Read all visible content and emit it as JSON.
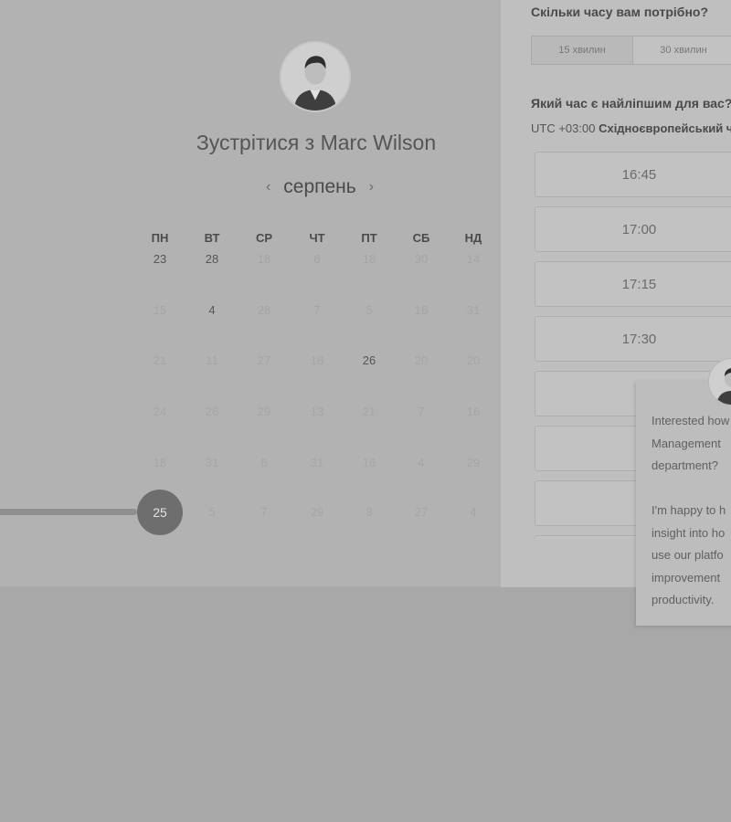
{
  "host": {
    "meet_title": "Зустрітися з Marc Wilson"
  },
  "calendar": {
    "prev_arrow": "‹",
    "next_arrow": "›",
    "month": "серпень",
    "weekdays": [
      "ПН",
      "ВТ",
      "СР",
      "ЧТ",
      "ПТ",
      "СБ",
      "НД"
    ],
    "weeks": [
      [
        {
          "d": "23",
          "a": true
        },
        {
          "d": "28",
          "a": true
        },
        {
          "d": "18",
          "a": false
        },
        {
          "d": "6",
          "a": false
        },
        {
          "d": "18",
          "a": false
        },
        {
          "d": "30",
          "a": false
        },
        {
          "d": "14",
          "a": false
        }
      ],
      [
        {
          "d": "15",
          "a": false
        },
        {
          "d": "4",
          "a": true
        },
        {
          "d": "28",
          "a": false
        },
        {
          "d": "7",
          "a": false
        },
        {
          "d": "5",
          "a": false
        },
        {
          "d": "16",
          "a": false
        },
        {
          "d": "31",
          "a": false
        }
      ],
      [
        {
          "d": "21",
          "a": false
        },
        {
          "d": "11",
          "a": false
        },
        {
          "d": "27",
          "a": false
        },
        {
          "d": "18",
          "a": false
        },
        {
          "d": "26",
          "a": true
        },
        {
          "d": "20",
          "a": false
        },
        {
          "d": "20",
          "a": false
        }
      ],
      [
        {
          "d": "24",
          "a": false
        },
        {
          "d": "26",
          "a": false
        },
        {
          "d": "29",
          "a": false
        },
        {
          "d": "13",
          "a": false
        },
        {
          "d": "21",
          "a": false
        },
        {
          "d": "7",
          "a": false
        },
        {
          "d": "16",
          "a": false
        }
      ],
      [
        {
          "d": "18",
          "a": false
        },
        {
          "d": "31",
          "a": false
        },
        {
          "d": "8",
          "a": false
        },
        {
          "d": "31",
          "a": false
        },
        {
          "d": "16",
          "a": false
        },
        {
          "d": "4",
          "a": false
        },
        {
          "d": "29",
          "a": false
        }
      ],
      [
        {
          "d": "25",
          "a": true,
          "s": true
        },
        {
          "d": "5",
          "a": false
        },
        {
          "d": "7",
          "a": false
        },
        {
          "d": "29",
          "a": false
        },
        {
          "d": "3",
          "a": false
        },
        {
          "d": "27",
          "a": false
        },
        {
          "d": "4",
          "a": false
        }
      ]
    ]
  },
  "booking": {
    "duration_question": "Скільки часу вам потрібно?",
    "durations": [
      "15 хвилин",
      "30 хвилин"
    ],
    "time_question": "Який час є найліпшим для вас?",
    "tz_offset": "UTC +03:00",
    "tz_name": "Східноєвропейський час",
    "slots": [
      "16:45",
      "17:00",
      "17:15",
      "17:30",
      "",
      "",
      "",
      ""
    ]
  },
  "chat": {
    "message_lines": [
      "Interested how",
      "Management",
      "department?",
      "",
      "I'm happy to h",
      "insight into ho",
      "use our platfo",
      "improvement",
      "productivity."
    ]
  }
}
